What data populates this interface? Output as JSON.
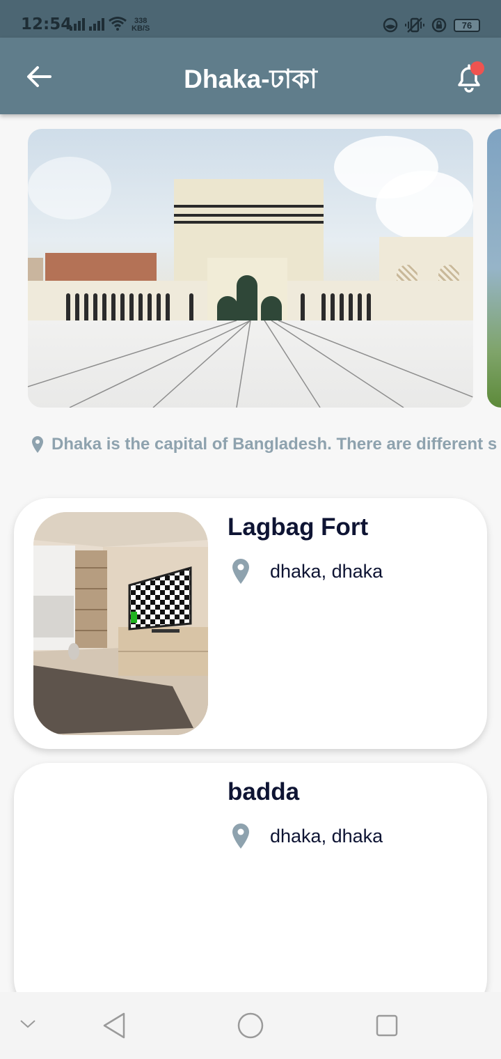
{
  "status_bar": {
    "time": "12:54",
    "net_speed_value": "338",
    "net_speed_unit": "KB/S",
    "battery": "76"
  },
  "app_bar": {
    "title": "Dhaka-ঢাকা",
    "back_icon": "arrow-left-icon",
    "notification_icon": "bell-icon",
    "accent_color": "#607d8b",
    "badge_color": "#ef5350"
  },
  "carousel": {
    "images": [
      "mosque-photo",
      "next-photo-partial"
    ]
  },
  "description": {
    "icon": "map-pin-icon",
    "text": "Dhaka is the capital of Bangladesh. There are different s"
  },
  "places": [
    {
      "title": "Lagbag Fort",
      "location": "dhaka, dhaka",
      "icon": "map-pin-icon"
    },
    {
      "title": "badda",
      "location": "dhaka, dhaka",
      "icon": "map-pin-icon"
    }
  ],
  "nav_bar": {
    "items": [
      "collapse-icon",
      "back-triangle-icon",
      "home-circle-icon",
      "recents-square-icon"
    ]
  }
}
